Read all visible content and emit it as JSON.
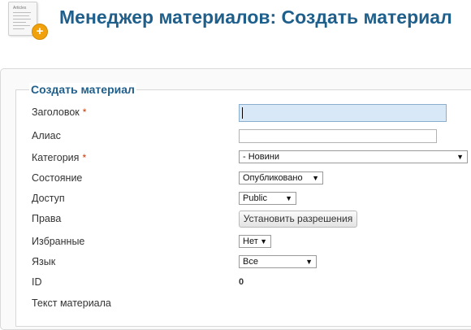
{
  "header": {
    "title": "Менеджер материалов: Создать материал",
    "icon_label": "Articles",
    "icons": [
      "article-document-icon",
      "add-plus-icon"
    ]
  },
  "form": {
    "legend": "Создать материал",
    "fields": {
      "title": {
        "label": "Заголовок",
        "required_mark": "*",
        "value": ""
      },
      "alias": {
        "label": "Алиас",
        "value": ""
      },
      "category": {
        "label": "Категория",
        "required_mark": "*",
        "selected": "- Новини"
      },
      "state": {
        "label": "Состояние",
        "selected": "Опубликовано"
      },
      "access": {
        "label": "Доступ",
        "selected": "Public"
      },
      "permissions": {
        "label": "Права",
        "button_label": "Установить разрешения"
      },
      "featured": {
        "label": "Избранные",
        "selected": "Нет"
      },
      "language": {
        "label": "Язык",
        "selected": "Все"
      },
      "id": {
        "label": "ID",
        "value": "0"
      },
      "article_text": {
        "label": "Текст материала"
      }
    }
  },
  "colors": {
    "title": "#1f5f8c",
    "required": "#cc3300",
    "focused_input": "#d8e8f6",
    "plus_icon": "#f0a10c"
  }
}
